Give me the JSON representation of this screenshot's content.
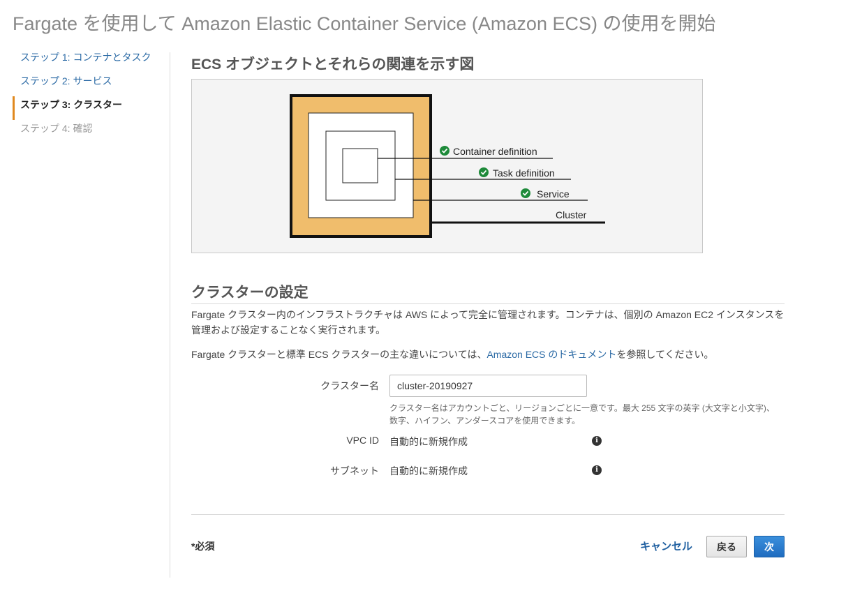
{
  "page": {
    "title": "Fargate を使用して Amazon Elastic Container Service (Amazon ECS) の使用を開始"
  },
  "steps": [
    {
      "label": "ステップ 1: コンテナとタスク",
      "state": "link"
    },
    {
      "label": "ステップ 2: サービス",
      "state": "link"
    },
    {
      "label": "ステップ 3: クラスター",
      "state": "active"
    },
    {
      "label": "ステップ 4: 確認",
      "state": "disabled"
    }
  ],
  "diagram": {
    "title": "ECS オブジェクトとそれらの関連を示す図",
    "labels": {
      "container": "Container definition",
      "task": "Task definition",
      "service": "Service",
      "cluster": "Cluster"
    },
    "colors": {
      "cluster_fill": "#f0bd6c",
      "check": "#1e8a3a"
    },
    "icons": [
      "check-circle-icon"
    ]
  },
  "cluster_settings": {
    "title": "クラスターの設定",
    "description": "Fargate クラスター内のインフラストラクチャは AWS によって完全に管理されます。コンテナは、個別の Amazon EC2 インスタンスを管理および設定することなく実行されます。",
    "diff_prefix": "Fargate クラスターと標準 ECS クラスターの主な違いについては、",
    "diff_link": "Amazon ECS のドキュメント",
    "diff_suffix": "を参照してください。",
    "name_label": "クラスター名",
    "name_value": "cluster-20190927",
    "name_help_line1": "クラスター名はアカウントごと、リージョンごとに一意です。最大 255 文字の英字 (大文字と小文字)、",
    "name_help_line2": "数字、ハイフン、アンダースコアを使用できます。",
    "vpc_label": "VPC ID",
    "vpc_value": "自動的に新規作成",
    "subnet_label": "サブネット",
    "subnet_value": "自動的に新規作成"
  },
  "footer": {
    "required": "*必須",
    "cancel": "キャンセル",
    "back": "戻る",
    "next": "次"
  },
  "colors": {
    "accent": "#e0891f",
    "link": "#2b6aa5",
    "primary_button": "#1f6cc0"
  }
}
